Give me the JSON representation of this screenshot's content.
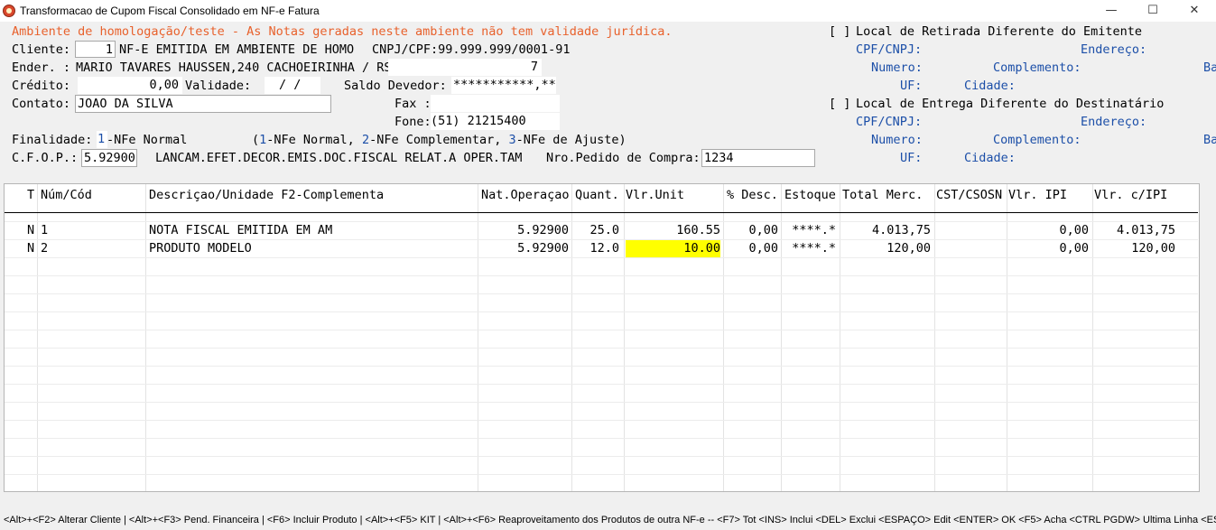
{
  "window": {
    "title": "Transformacao de Cupom Fiscal Consolidado em NF-e Fatura",
    "minimize": "—",
    "maximize": "☐",
    "close": "✕"
  },
  "warning": "Ambiente de homologação/teste - As Notas geradas neste ambiente não tem validade jurídica.",
  "form": {
    "cliente_label": "Cliente:",
    "cliente_code": "1",
    "cliente_name": "NF-E EMITIDA EM AMBIENTE DE HOMO",
    "cnpj": "CNPJ/CPF:99.999.999/0001-91",
    "ender_label": "Ender. :",
    "ender_value": "MARIO TAVARES HAUSSEN,240 CACHOEIRINHA / RS",
    "ender_number": "7",
    "credito_label": "Crédito:",
    "credito_value": "0,00",
    "validade_label": "Validade:",
    "validade_value": "/  /",
    "saldo_label": "Saldo Devedor:",
    "saldo_value": "***********,**",
    "contato_label": "Contato:",
    "contato_value": "JOAO DA SILVA",
    "fax_label": "Fax :",
    "fone_label": "Fone:",
    "fone_value": "(51) 21215400",
    "finalidade_label": "Finalidade:",
    "finalidade_code": "1",
    "finalidade_desc": "-NFe Normal",
    "finalidade_hint_open": "(",
    "finalidade_hint_1": "1",
    "finalidade_hint_1t": "-NFe Normal, ",
    "finalidade_hint_2": "2",
    "finalidade_hint_2t": "-NFe Complementar, ",
    "finalidade_hint_3": "3",
    "finalidade_hint_3t": "-NFe de Ajuste)",
    "cfop_label": "C.F.O.P.:",
    "cfop_value": "5.92900",
    "cfop_desc": "LANCAM.EFET.DECOR.EMIS.DOC.FISCAL RELAT.A OPER.TAM",
    "pedido_label": "Nro.Pedido de Compra:",
    "pedido_value": "1234"
  },
  "retirada": {
    "checkbox": "[ ]",
    "title": "Local de Retirada Diferente do Emitente",
    "cpf": "CPF/CNPJ:",
    "endereco": "Endereço:",
    "numero": "Numero:",
    "complemento": "Complemento:",
    "bairro": "Ba",
    "uf": "UF:",
    "cidade": "Cidade:"
  },
  "entrega": {
    "checkbox": "[ ]",
    "title": "Local de Entrega Diferente do Destinatário",
    "cpf": "CPF/CNPJ:",
    "endereco": "Endereço:",
    "numero": "Numero:",
    "complemento": "Complemento:",
    "bairro": "Ba",
    "uf": "UF:",
    "cidade": "Cidade:"
  },
  "grid": {
    "headers": [
      "T",
      "Núm/Cód",
      "Descriçao/Unidade F2-Complementa",
      "Nat.Operaçao",
      "Quant.",
      "Vlr.Unit",
      "% Desc.",
      "Estoque",
      "Total Merc.",
      "CST/CSOSN",
      "Vlr. IPI",
      "Vlr. c/IPI"
    ],
    "rows": [
      {
        "t": "N",
        "num": "1",
        "desc": "NOTA FISCAL EMITIDA EM AM",
        "nat": "5.92900",
        "qty": "25.0",
        "unit": "160.55",
        "desc_pct": "0,00",
        "estoque": "****.*",
        "total": "4.013,75",
        "cst": "",
        "ipi": "0,00",
        "total_ipi": "4.013,75"
      },
      {
        "t": "N",
        "num": "2",
        "desc": "PRODUTO MODELO",
        "nat": "5.92900",
        "qty": "12.0",
        "unit": "10.00",
        "desc_pct": "0,00",
        "estoque": "****.*",
        "total": "120,00",
        "cst": "",
        "ipi": "0,00",
        "total_ipi": "120,00"
      }
    ],
    "highlight_color": "#ffff00"
  },
  "footer": "<Alt>+<F2> Alterar Cliente | <Alt>+<F3> Pend. Financeira | <F6> Incluir Produto  |  <Alt>+<F5> KIT |  <Alt>+<F6> Reaproveitamento dos Produtos de outra NF-e  --   <F7> Tot  <INS> Inclui  <DEL> Exclui  <ESPAÇO> Edit  <ENTER> OK  <F5> Acha   <CTRL PGDW> Ultima Linha   <ESC> S"
}
